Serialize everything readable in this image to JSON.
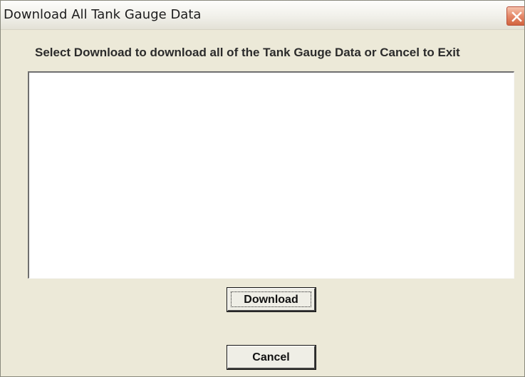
{
  "window": {
    "title": "Download All Tank Gauge Data"
  },
  "titlebar": {
    "close_icon": "close-icon"
  },
  "dialog": {
    "instruction": "Select Download to download all of the Tank Gauge Data or Cancel to Exit",
    "download_label": "Download",
    "cancel_label": "Cancel"
  },
  "colors": {
    "window_background": "#ece9d8",
    "close_button": "#d2633f"
  }
}
